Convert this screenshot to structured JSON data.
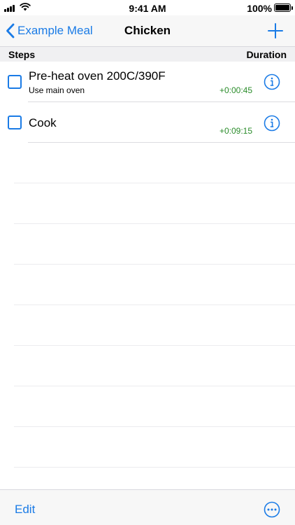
{
  "status_bar": {
    "time": "9:41 AM",
    "battery": "100%",
    "icons": [
      "signal-icon",
      "wifi-icon",
      "battery-icon"
    ]
  },
  "nav": {
    "back_label": "Example Meal",
    "title": "Chicken",
    "back_icon": "chevron-left-icon",
    "add_icon": "plus-icon"
  },
  "section": {
    "steps_label": "Steps",
    "duration_label": "Duration"
  },
  "steps": [
    {
      "title": "Pre-heat oven 200C/390F",
      "subtitle": "Use main oven",
      "duration": "+0:00:45",
      "checked": false
    },
    {
      "title": "Cook",
      "subtitle": "",
      "duration": "+0:09:15",
      "checked": false
    }
  ],
  "toolbar": {
    "edit_label": "Edit",
    "more_icon": "ellipsis-circle-icon"
  },
  "colors": {
    "accent": "#1a7be6",
    "duration": "#2a8c2a",
    "bar_background": "#f7f7f7",
    "separator": "#dcdce0"
  }
}
